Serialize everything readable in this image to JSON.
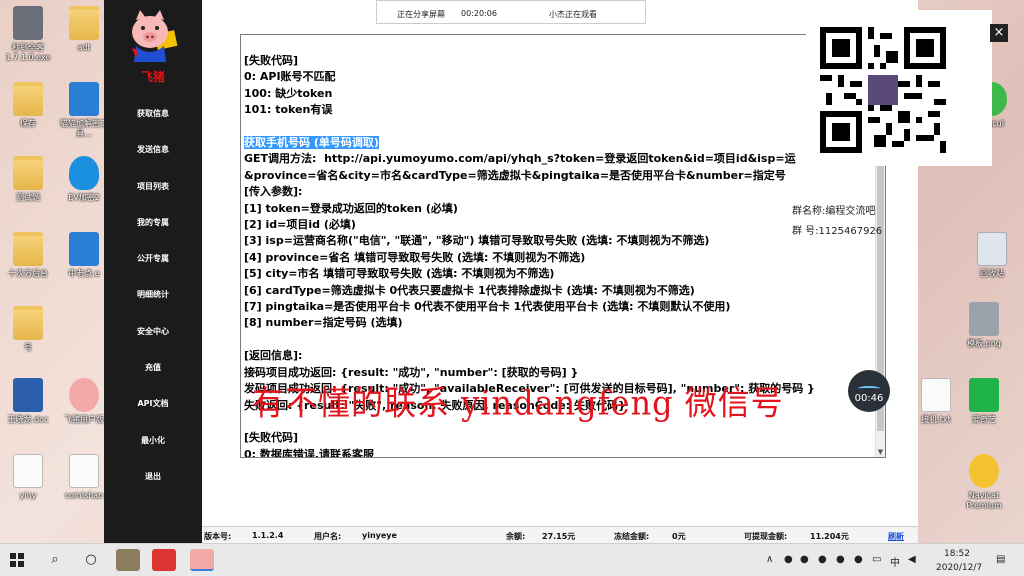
{
  "desktop": {
    "left_icons": [
      {
        "label": "秒到全客1.7.1.0.exe",
        "icon": "exe-icon"
      },
      {
        "label": "adt",
        "icon": "folder-icon"
      },
      {
        "label": "保存",
        "icon": "folder-icon"
      },
      {
        "label": "猫猫加解密工具...",
        "icon": "app-icon"
      },
      {
        "label": "测试题",
        "icon": "folder-icon"
      },
      {
        "label": "EV加密2",
        "icon": "shield-icon"
      },
      {
        "label": "十次方后台",
        "icon": "folder-icon"
      },
      {
        "label": "中老点.e",
        "icon": "app-icon"
      },
      {
        "label": "号",
        "icon": "folder-icon"
      },
      {
        "label": "王晓龙.doc",
        "icon": "word-icon"
      },
      {
        "label": "飞猪用户版",
        "icon": "pig-icon"
      },
      {
        "label": "yiny",
        "icon": "doc-icon"
      },
      {
        "label": "comishan",
        "icon": "doc-icon"
      }
    ],
    "right_icons": [
      {
        "label": "imjcul",
        "icon": "app-icon"
      },
      {
        "label": "回收站",
        "icon": "recycle-bin-icon"
      },
      {
        "label": "模板.png",
        "icon": "image-icon"
      },
      {
        "label": "爱奇艺",
        "icon": "iqiyi-icon"
      },
      {
        "label": "接机.txt",
        "icon": "doc-icon"
      },
      {
        "label": "Navicat Premium",
        "icon": "navicat-icon"
      }
    ]
  },
  "sidebar": {
    "brand": "飞猪",
    "items": [
      {
        "label": "获取信息"
      },
      {
        "label": "发送信息"
      },
      {
        "label": "项目列表"
      },
      {
        "label": "我的专属"
      },
      {
        "label": "公开专属"
      },
      {
        "label": "明细统计"
      },
      {
        "label": "安全中心"
      },
      {
        "label": "充值"
      },
      {
        "label": "API文档"
      },
      {
        "label": "最小化"
      },
      {
        "label": "退出"
      }
    ]
  },
  "doc_lines": [
    {
      "text": "[失败代码]",
      "selected": false
    },
    {
      "text": "0: API账号不匹配",
      "selected": false
    },
    {
      "text": "100: 缺少token",
      "selected": false
    },
    {
      "text": "101: token有误",
      "selected": false
    },
    {
      "text": "",
      "selected": false
    },
    {
      "text": "获取手机号码 (单号码调取)",
      "selected": true
    },
    {
      "text": "GET调用方法:  http://api.yumoyumo.com/api/yhqh_s?token=登录返回token&id=项目id&isp=运",
      "selected": false
    },
    {
      "text": "&province=省名&city=市名&cardType=筛选虚拟卡&pingtaika=是否使用平台卡&number=指定号",
      "selected": false
    },
    {
      "text": "[传入参数]:",
      "selected": false
    },
    {
      "text": "[1] token=登录成功返回的token (必填)",
      "selected": false
    },
    {
      "text": "[2] id=项目id (必填)",
      "selected": false
    },
    {
      "text": "[3] isp=运营商名称(\"电信\", \"联通\", \"移动\") 填错可导致取号失败 (选填: 不填则视为不筛选)",
      "selected": false
    },
    {
      "text": "[4] province=省名 填错可导致取号失败 (选填: 不填则视为不筛选)",
      "selected": false
    },
    {
      "text": "[5] city=市名 填错可导致取号失败 (选填: 不填则视为不筛选)",
      "selected": false
    },
    {
      "text": "[6] cardType=筛选虚拟卡 0代表只要虚拟卡 1代表排除虚拟卡 (选填: 不填则视为不筛选)",
      "selected": false
    },
    {
      "text": "[7] pingtaika=是否使用平台卡 0代表不使用平台卡 1代表使用平台卡 (选填: 不填则默认不使用)",
      "selected": false
    },
    {
      "text": "[8] number=指定号码 (选填)",
      "selected": false
    },
    {
      "text": "",
      "selected": false
    },
    {
      "text": "[返回信息]:",
      "selected": false
    },
    {
      "text": "接码项目成功返回: {result: \"成功\", \"number\": [获取的号码] }",
      "selected": false
    },
    {
      "text": "发码项目成功返回: {result: \"成功\", \"availableReceiver\": [可供发送的目标号码], \"number\": 获取的号码 }",
      "selected": false
    },
    {
      "text": "失败返回: {result: \"失败\", reason: 失败原因, reasonCode: 失败代码}",
      "selected": false
    },
    {
      "text": "",
      "selected": false
    },
    {
      "text": "[失败代码]",
      "selected": false
    },
    {
      "text": "0: 数据库错误,请联系客服",
      "selected": false
    }
  ],
  "status_bar": {
    "version_label": "版本号:",
    "version": "1.1.2.4",
    "user_label": "用户名:",
    "user": "yinyeye",
    "balance_label": "余额:",
    "balance": "27.15元",
    "frozen_label": "冻结金额:",
    "frozen": "0元",
    "withdrawable_label": "可提现金额:",
    "withdrawable": "11.204元",
    "refresh": "刷新"
  },
  "share_bar": {
    "status": "正在分享屏幕",
    "time": "00:20:06",
    "viewer": "小杰正在观看"
  },
  "overlay": {
    "close": "×",
    "group_name": "群名称:编程交流吧",
    "group_id": "群    号:1125467926",
    "watermark": "有不懂的联系  yindangfeng  微信号",
    "timer": "00:46"
  },
  "taskbar": {
    "tray_ime": "中",
    "time": "18:52",
    "date": "2020/12/7"
  },
  "colors": {
    "sidebar_bg": "#1b1b1b",
    "brand_red": "#e0141a",
    "watermark_red": "#e3141c",
    "selection": "#3399ff",
    "link_blue": "#1b4fd6"
  }
}
